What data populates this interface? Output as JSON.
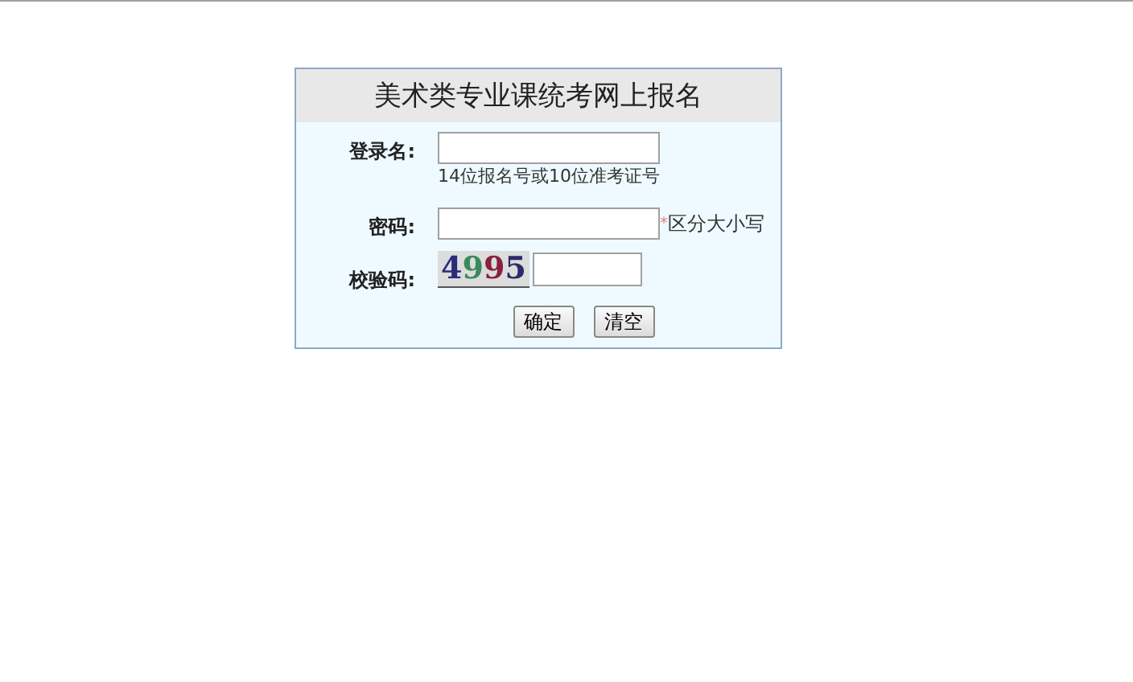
{
  "form": {
    "title": "美术类专业课统考网上报名",
    "fields": [
      {
        "kind": "text",
        "label": "登录名:",
        "hint": "14位报名号或10位准考证号"
      },
      {
        "kind": "password",
        "label": "密码:",
        "required_mark": "*",
        "note": "区分大小写"
      },
      {
        "kind": "captcha",
        "label": "校验码:",
        "captcha": [
          {
            "char": "4",
            "color": "#2b2b7a"
          },
          {
            "char": "9",
            "color": "#3a8a5a"
          },
          {
            "char": "9",
            "color": "#8a2040"
          },
          {
            "char": "5",
            "color": "#2b2b6a"
          }
        ]
      }
    ],
    "buttons": [
      "确定",
      "清空"
    ]
  }
}
